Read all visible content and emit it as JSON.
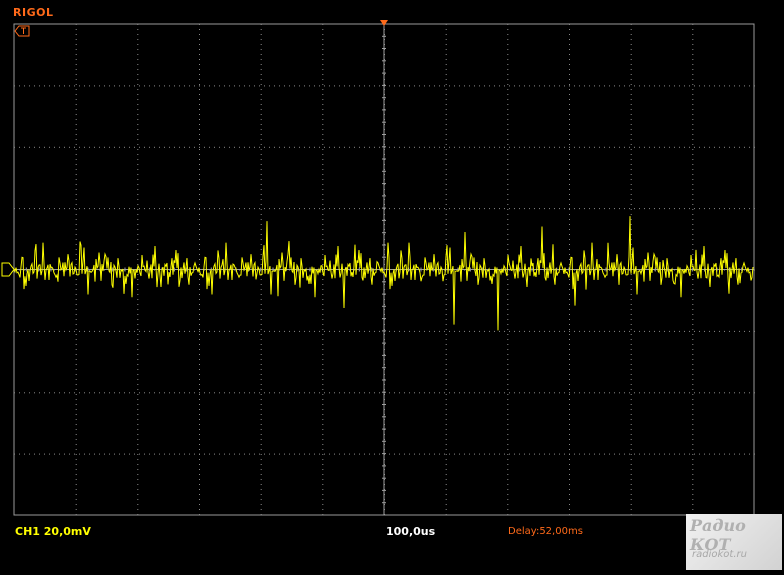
{
  "brand": "RIGOL",
  "status_bar": {
    "channel": "CH1 20,0mV",
    "timebase": "100,0us",
    "delay": "Delay:52,00ms"
  },
  "watermark": {
    "top": "Радио КОТ",
    "bottom": "radiokot.ru"
  },
  "colors": {
    "trace": "#ffff00",
    "grid": "#9a9a9a",
    "brand": "#ff6a1a",
    "background": "#000000"
  },
  "icons": [
    "trigger-level-icon",
    "trigger-position-icon",
    "channel-ground-icon"
  ],
  "chart_data": {
    "type": "line",
    "grid": true,
    "divisions": {
      "horizontal": 12,
      "vertical": 8
    },
    "series": [
      {
        "values": [
          0,
          3,
          -4,
          10,
          -7,
          2,
          -12,
          5,
          14,
          -3,
          -18,
          4,
          28,
          -6,
          2,
          -9,
          16,
          -2,
          -25,
          6,
          48,
          -8,
          3,
          -11,
          -4,
          20,
          -15,
          7,
          -3,
          12,
          -22,
          5,
          -1,
          9,
          -14,
          3,
          38,
          -6,
          -30,
          5,
          11,
          -2,
          -19,
          8,
          4,
          -7,
          24,
          -13,
          2,
          -5,
          17,
          -3,
          -28,
          6,
          -10,
          3,
          15,
          -6,
          33,
          -4,
          -12,
          8,
          -3,
          21,
          -17,
          4,
          -9,
          6,
          -2,
          14,
          -36,
          5,
          42,
          -8,
          3,
          -15,
          10,
          -4,
          -20,
          7,
          -6,
          18,
          -3,
          9,
          -26,
          4,
          -11,
          5,
          30,
          -7,
          2,
          -13,
          12,
          -3,
          -50,
          6,
          28,
          -5,
          3,
          -8,
          16,
          -12,
          4,
          55,
          -2,
          -22,
          7,
          -9,
          3,
          26,
          -4,
          -14,
          5,
          11,
          -31,
          3,
          -6,
          19,
          -8,
          4,
          -16,
          2,
          8,
          -3,
          44,
          -10,
          6,
          -21,
          3,
          -5,
          14,
          -7,
          25,
          -13,
          4,
          -9,
          6,
          -27,
          3,
          17,
          -4,
          -11,
          9,
          2,
          -18,
          5,
          -3,
          36,
          -6,
          3,
          -14,
          10,
          -40,
          4,
          22,
          -8,
          3,
          -12,
          7,
          -5,
          15,
          -19,
          6,
          -2,
          28,
          -9,
          4,
          -16,
          3,
          11,
          -7,
          5,
          -24,
          2,
          13,
          -4,
          8,
          -32,
          6,
          19,
          -3,
          -10,
          4
        ]
      }
    ]
  }
}
